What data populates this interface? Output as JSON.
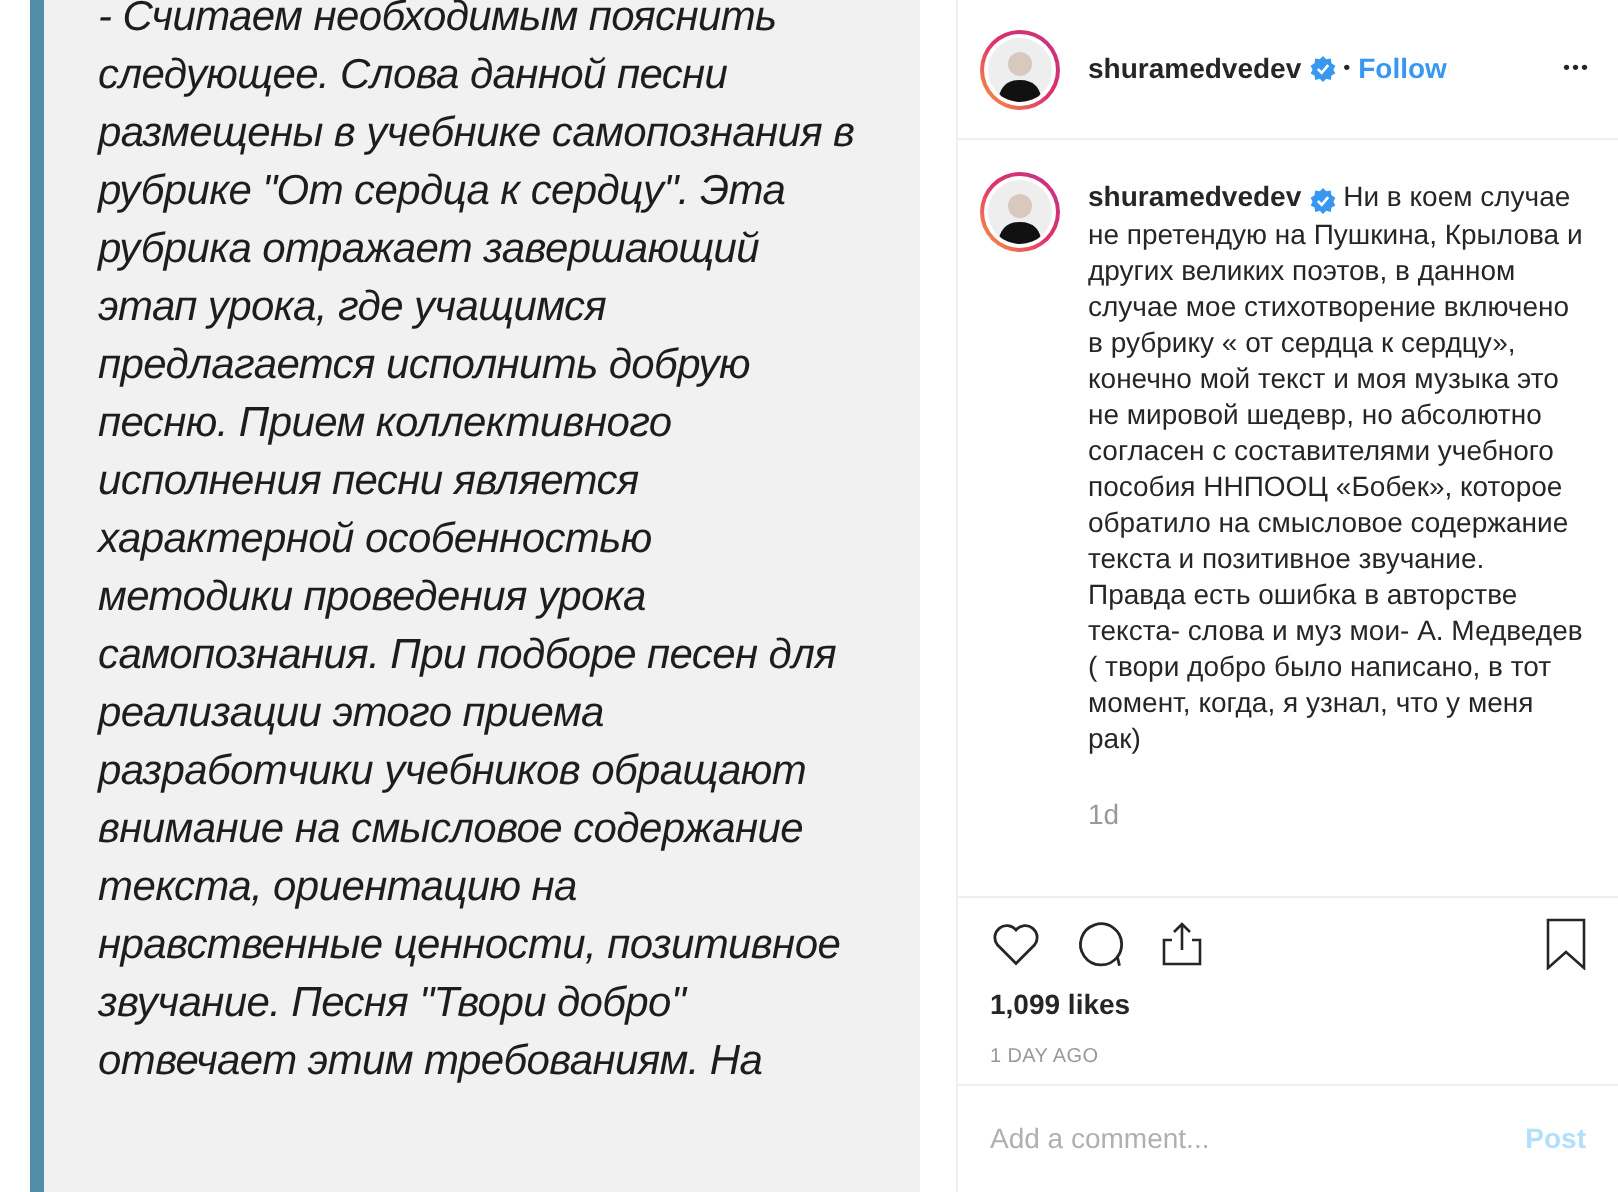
{
  "post_image": {
    "lines": [
      "- Считаем необходимым пояснить",
      "следующее. Слова данной песни",
      "размещены в учебнике самопознания в",
      "рубрике \"От сердца к сердцу\". Эта",
      "рубрика отражает завершающий",
      "этап урока, где учащимся",
      "предлагается исполнить добрую",
      "песню. Прием коллективного",
      "исполнения песни является",
      "характерной особенностью",
      "методики проведения урока",
      "самопознания. При подборе песен для",
      "реализации этого приема",
      "разработчики учебников обращают",
      "внимание на смысловое содержание",
      "текста, ориентацию на",
      "нравственные ценности, позитивное",
      "звучание. Песня \"Твори добро\"",
      "отвечает этим требованиям. На"
    ]
  },
  "header": {
    "username": "shuramedvedev",
    "verified": true,
    "separator": "•",
    "follow": "Follow",
    "more": "•••"
  },
  "caption": {
    "username": "shuramedvedev",
    "verified": true,
    "text": "Ни в коем случае не претендую на Пушкина, Крылова и других великих поэтов, в данном случае мое стихотворение включено в рубрику « от сердца к сердцу», конечно мой текст и моя музыка это не мировой шедевр, но абсолютно согласен с составителями учебного пособия ННПООЦ «Бобек», которое обратило на смысловое содержание текста и позитивное звучание. Правда есть ошибка в авторстве текста- слова и муз мои- А. Медведев ( твори добро было написано, в тот момент, когда, я узнал, что у меня рак)",
    "age": "1d"
  },
  "actions": {
    "liked": false,
    "saved": false,
    "likes": "1,099 likes",
    "posted": "1 DAY AGO"
  },
  "comment_box": {
    "placeholder": "Add a comment...",
    "post": "Post",
    "post_disabled": true
  }
}
